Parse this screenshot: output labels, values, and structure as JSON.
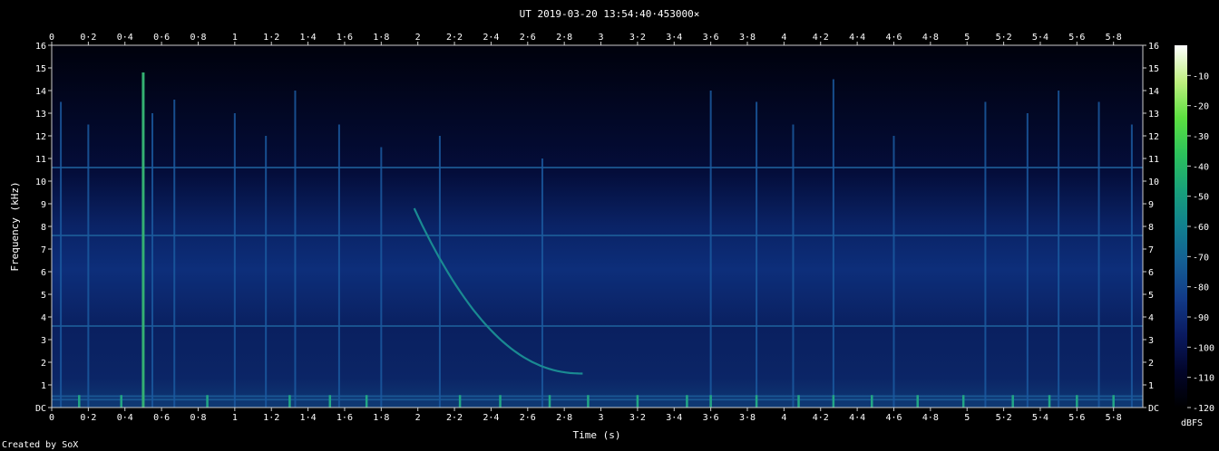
{
  "chart_data": {
    "type": "heatmap",
    "title": "UT 2019-03-20 13:54:40·453000×",
    "xlabel": "Time (s)",
    "ylabel": "Frequency (kHz)",
    "xlim": [
      0,
      5.96
    ],
    "ylim": [
      0,
      16
    ],
    "x_ticks": [
      "0",
      "0·2",
      "0·4",
      "0·6",
      "0·8",
      "1",
      "1·2",
      "1·4",
      "1·6",
      "1·8",
      "2",
      "2·2",
      "2·4",
      "2·6",
      "2·8",
      "3",
      "3·2",
      "3·4",
      "3·6",
      "3·8",
      "4",
      "4·2",
      "4·4",
      "4·6",
      "4·8",
      "5",
      "5·2",
      "5·4",
      "5·6",
      "5·8"
    ],
    "x_tick_values": [
      0,
      0.2,
      0.4,
      0.6,
      0.8,
      1.0,
      1.2,
      1.4,
      1.6,
      1.8,
      2.0,
      2.2,
      2.4,
      2.6,
      2.8,
      3.0,
      3.2,
      3.4,
      3.6,
      3.8,
      4.0,
      4.2,
      4.4,
      4.6,
      4.8,
      5.0,
      5.2,
      5.4,
      5.6,
      5.8
    ],
    "y_ticks": [
      "DC",
      "1",
      "2",
      "3",
      "4",
      "5",
      "6",
      "7",
      "8",
      "9",
      "10",
      "11",
      "12",
      "13",
      "14",
      "15",
      "16"
    ],
    "y_tick_values": [
      0,
      1,
      2,
      3,
      4,
      5,
      6,
      7,
      8,
      9,
      10,
      11,
      12,
      13,
      14,
      15,
      16
    ],
    "colorbar": {
      "label": "dBFS",
      "ticks": [
        "-10",
        "-20",
        "-30",
        "-40",
        "-50",
        "-60",
        "-70",
        "-80",
        "-90",
        "-100",
        "-110",
        "-120"
      ],
      "tick_values": [
        -10,
        -20,
        -30,
        -40,
        -50,
        -60,
        -70,
        -80,
        -90,
        -100,
        -110,
        -120
      ],
      "range": [
        -120,
        0
      ],
      "colors": [
        "#000000",
        "#02052a",
        "#0a1a60",
        "#123a88",
        "#145e94",
        "#11808f",
        "#18a07a",
        "#2cc25c",
        "#5ce040",
        "#bff080",
        "#ffffff"
      ]
    },
    "features": {
      "strong_impulse": {
        "t": 0.5,
        "f_max": 14.8,
        "level_dbfs": -40
      },
      "tone_bands_khz": [
        0.35,
        0.5,
        3.6,
        7.6,
        10.6
      ],
      "whistler": {
        "t_start": 1.98,
        "f_start": 8.8,
        "t_end": 2.9,
        "f_end": 1.5
      },
      "impulses": [
        {
          "t": 0.05,
          "f_max": 13.5
        },
        {
          "t": 0.2,
          "f_max": 12.5
        },
        {
          "t": 0.55,
          "f_max": 13.0
        },
        {
          "t": 0.67,
          "f_max": 13.6
        },
        {
          "t": 1.0,
          "f_max": 13.0
        },
        {
          "t": 1.17,
          "f_max": 12.0
        },
        {
          "t": 1.33,
          "f_max": 14.0
        },
        {
          "t": 1.57,
          "f_max": 12.5
        },
        {
          "t": 1.8,
          "f_max": 11.5
        },
        {
          "t": 2.12,
          "f_max": 12.0
        },
        {
          "t": 2.68,
          "f_max": 11.0
        },
        {
          "t": 3.6,
          "f_max": 14.0
        },
        {
          "t": 3.85,
          "f_max": 13.5
        },
        {
          "t": 4.05,
          "f_max": 12.5
        },
        {
          "t": 4.27,
          "f_max": 14.5
        },
        {
          "t": 4.6,
          "f_max": 12.0
        },
        {
          "t": 5.1,
          "f_max": 13.5
        },
        {
          "t": 5.33,
          "f_max": 13.0
        },
        {
          "t": 5.5,
          "f_max": 14.0
        },
        {
          "t": 5.72,
          "f_max": 13.5
        },
        {
          "t": 5.9,
          "f_max": 12.5
        }
      ],
      "floor_pulses_t": [
        0.15,
        0.38,
        0.5,
        0.85,
        1.3,
        1.52,
        1.72,
        2.23,
        2.45,
        2.72,
        2.93,
        3.2,
        3.47,
        3.6,
        3.85,
        4.08,
        4.27,
        4.48,
        4.73,
        4.98,
        5.25,
        5.45,
        5.6,
        5.8
      ]
    }
  },
  "credit": "Created by SoX"
}
